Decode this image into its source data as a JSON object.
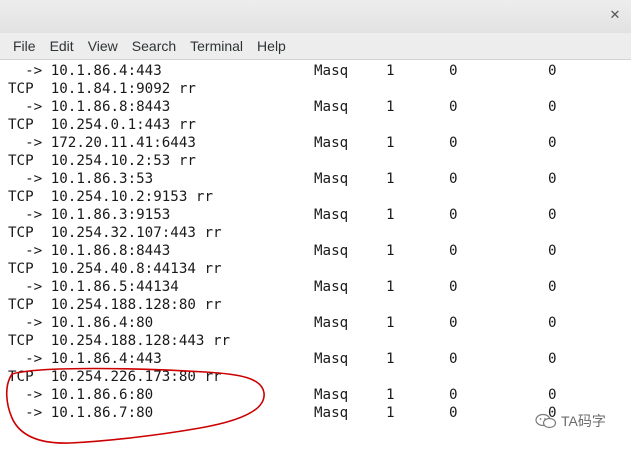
{
  "window": {
    "close_glyph": "✕"
  },
  "menu": [
    "File",
    "Edit",
    "View",
    "Search",
    "Terminal",
    "Help"
  ],
  "rows": [
    {
      "kind": "dest",
      "addr": "  -> 10.1.86.4:443",
      "fwd": "Masq",
      "weight": "1",
      "active": "0",
      "inact": "0"
    },
    {
      "kind": "svc",
      "text": "TCP  10.1.84.1:9092 rr"
    },
    {
      "kind": "dest",
      "addr": "  -> 10.1.86.8:8443",
      "fwd": "Masq",
      "weight": "1",
      "active": "0",
      "inact": "0"
    },
    {
      "kind": "svc",
      "text": "TCP  10.254.0.1:443 rr"
    },
    {
      "kind": "dest",
      "addr": "  -> 172.20.11.41:6443",
      "fwd": "Masq",
      "weight": "1",
      "active": "0",
      "inact": "0"
    },
    {
      "kind": "svc",
      "text": "TCP  10.254.10.2:53 rr"
    },
    {
      "kind": "dest",
      "addr": "  -> 10.1.86.3:53",
      "fwd": "Masq",
      "weight": "1",
      "active": "0",
      "inact": "0"
    },
    {
      "kind": "svc",
      "text": "TCP  10.254.10.2:9153 rr"
    },
    {
      "kind": "dest",
      "addr": "  -> 10.1.86.3:9153",
      "fwd": "Masq",
      "weight": "1",
      "active": "0",
      "inact": "0"
    },
    {
      "kind": "svc",
      "text": "TCP  10.254.32.107:443 rr"
    },
    {
      "kind": "dest",
      "addr": "  -> 10.1.86.8:8443",
      "fwd": "Masq",
      "weight": "1",
      "active": "0",
      "inact": "0"
    },
    {
      "kind": "svc",
      "text": "TCP  10.254.40.8:44134 rr"
    },
    {
      "kind": "dest",
      "addr": "  -> 10.1.86.5:44134",
      "fwd": "Masq",
      "weight": "1",
      "active": "0",
      "inact": "0"
    },
    {
      "kind": "svc",
      "text": "TCP  10.254.188.128:80 rr"
    },
    {
      "kind": "dest",
      "addr": "  -> 10.1.86.4:80",
      "fwd": "Masq",
      "weight": "1",
      "active": "0",
      "inact": "0"
    },
    {
      "kind": "svc",
      "text": "TCP  10.254.188.128:443 rr"
    },
    {
      "kind": "dest",
      "addr": "  -> 10.1.86.4:443",
      "fwd": "Masq",
      "weight": "1",
      "active": "0",
      "inact": "0"
    },
    {
      "kind": "svc",
      "text": "TCP  10.254.226.173:80 rr"
    },
    {
      "kind": "dest",
      "addr": "  -> 10.1.86.6:80",
      "fwd": "Masq",
      "weight": "1",
      "active": "0",
      "inact": "0"
    },
    {
      "kind": "dest",
      "addr": "  -> 10.1.86.7:80",
      "fwd": "Masq",
      "weight": "1",
      "active": "0",
      "inact": "0"
    }
  ],
  "annotation": {
    "color": "#cc0000"
  },
  "watermark": {
    "text": "TA码字",
    "icon": "wechat-icon"
  }
}
